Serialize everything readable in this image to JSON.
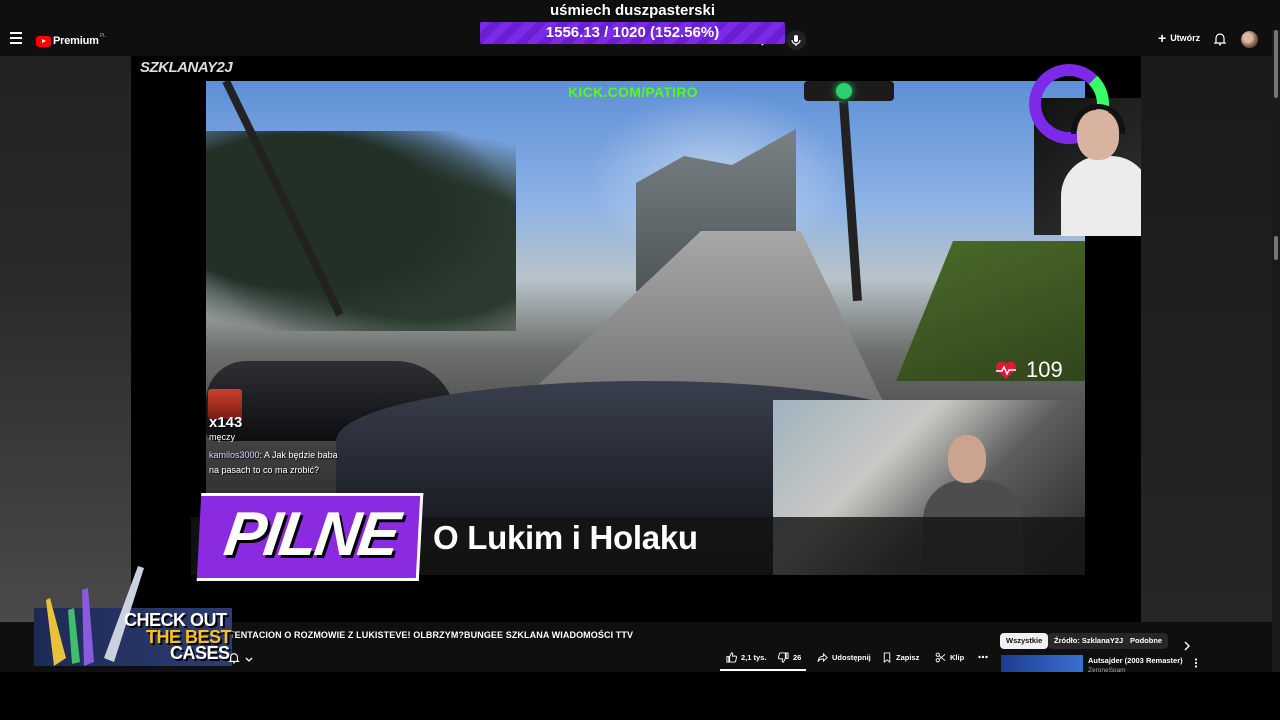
{
  "header": {
    "logo_text": "Premium",
    "logo_region": "PL",
    "stream_title": "uśmiech duszpasterski",
    "goal_text": "1556.13 / 1020 (152.56%)",
    "create_label": "Utwórz"
  },
  "player": {
    "channel_watermark": "SZKLANAY2J",
    "kick_url": "KICK.COM/PATIRO",
    "heart_rate": "109",
    "chat": {
      "multiplier": "x143",
      "sub_text": "męczy",
      "username": "kamilos3000",
      "message": ": A Jak będzie baba na pasach to co ma zrobić?"
    },
    "banner_tag": "PILNE",
    "banner_headline": "O Lukim i Holaku"
  },
  "ad": {
    "line1": "CHECK OUT",
    "line2": "THE BEST",
    "line3": "CASES"
  },
  "video": {
    "title": "TENTACION O ROZMOWIE Z LUKISTEVE! OLBRZYM?BUNGEE SZKLANA WIADOMOŚCI TTV",
    "likes": "2,1 tys.",
    "dislikes": "26",
    "share_label": "Udostępnij",
    "save_label": "Zapisz",
    "clip_label": "Klip"
  },
  "chips": [
    "Wszystkie",
    "Źródło: SzklanaY2J",
    "Podobne"
  ],
  "recommendation": {
    "title": "Autsajder (2003 Remaster)",
    "channel": "ZeroneSpam"
  },
  "colors": {
    "accent_purple": "#7d2ae8",
    "kick_green": "#53fc18",
    "youtube_red": "#ff0000"
  }
}
